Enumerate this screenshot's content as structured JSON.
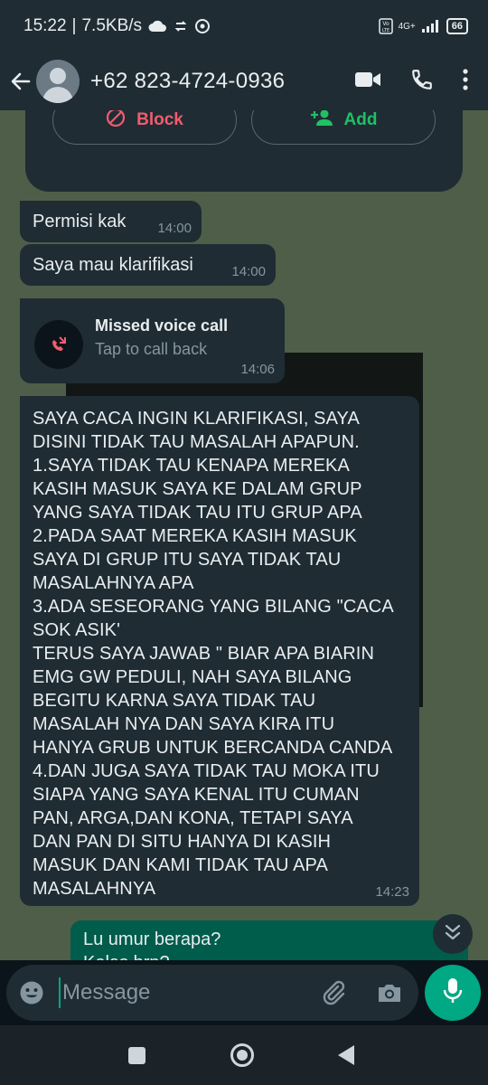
{
  "status_bar": {
    "time": "15:22",
    "network_speed": "7.5KB/s",
    "network_type": "4G+",
    "battery": "66"
  },
  "header": {
    "contact_name": "+62 823-4724-0936"
  },
  "contact_card": {
    "block_label": "Block",
    "add_label": "Add"
  },
  "messages": [
    {
      "text": "Permisi kak",
      "time": "14:00",
      "direction": "incoming"
    },
    {
      "text": "Saya mau klarifikasi",
      "time": "14:00",
      "direction": "incoming"
    },
    {
      "type": "missed_call",
      "title": "Missed voice call",
      "subtitle": "Tap to call back",
      "time": "14:06",
      "direction": "incoming"
    },
    {
      "text": "SAYA CACA INGIN KLARIFIKASI, SAYA\nDISINI TIDAK TAU MASALAH APAPUN.\n1.SAYA TIDAK TAU KENAPA MEREKA\nKASIH MASUK SAYA KE DALAM GRUP\nYANG SAYA TIDAK TAU ITU GRUP APA\n2.PADA SAAT MEREKA KASIH MASUK\nSAYA DI GRUP ITU SAYA TIDAK TAU\nMASALAHNYA APA\n3.ADA SESEORANG YANG BILANG \"CACA\nSOK ASIK'\nTERUS SAYA JAWAB \" BIAR APA BIARIN\nEMG GW PEDULI, NAH SAYA BILANG\nBEGITU KARNA SAYA TIDAK TAU\nMASALAH NYA DAN SAYA KIRA ITU\nHANYA GRUB UNTUK BERCANDA CANDA\n4.DAN JUGA SAYA TIDAK TAU MOKA ITU\nSIAPA YANG SAYA KENAL ITU CUMAN\nPAN, ARGA,DAN KONA, TETAPI SAYA\nDAN PAN DI SITU HANYA DI KASIH\nMASUK DAN KAMI TIDAK TAU APA\nMASALAHNYA",
      "time": "14:23",
      "direction": "incoming"
    },
    {
      "text": "Lu umur berapa?\nKelas brp?",
      "direction": "outgoing"
    }
  ],
  "composer": {
    "placeholder": "Message"
  },
  "colors": {
    "chat_background": "#4f5e48",
    "bubble_incoming": "#1f2c34",
    "bubble_outgoing": "#005c4b",
    "accent": "#00a884",
    "block_red": "#f15c6d",
    "add_green": "#21c063"
  }
}
